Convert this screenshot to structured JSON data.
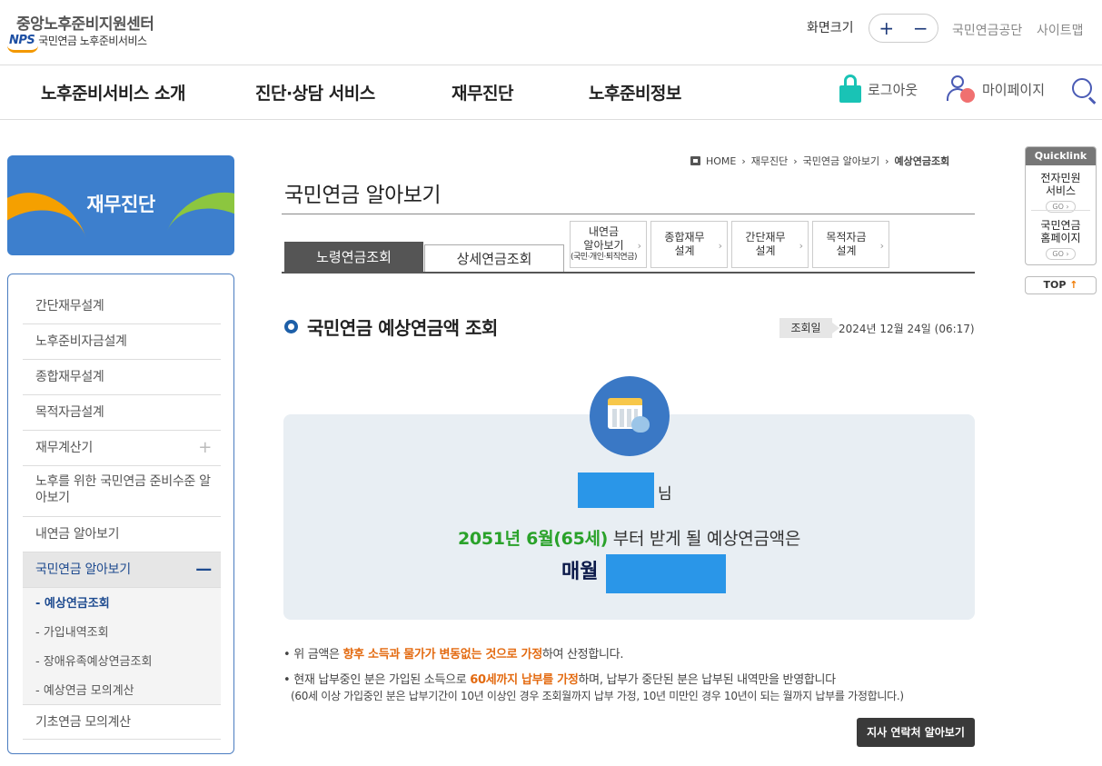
{
  "header": {
    "org_title": "중앙노후준비지원센터",
    "nps_logo_text": "NPS",
    "logo_sub": "국민연금 노후준비서비스",
    "font_size_label": "화면크기",
    "font_increase": "+",
    "font_decrease": "−",
    "links": [
      "국민연금공단",
      "사이트맵"
    ]
  },
  "gnb": {
    "items": [
      "노후준비서비스 소개",
      "진단·상담 서비스",
      "재무진단",
      "노후준비정보"
    ],
    "logout": "로그아웃",
    "mypage": "마이페이지"
  },
  "sidebar": {
    "banner_title": "재무진단",
    "items": [
      "간단재무설계",
      "노후준비자금설계",
      "종합재무설계",
      "목적자금설계",
      "재무계산기",
      "노후를 위한 국민연금 준비수준 알아보기",
      "내연금 알아보기",
      "국민연금 알아보기",
      "기초연금 모의계산"
    ],
    "plus": "+",
    "minus": "—",
    "subitems": [
      "- 예상연금조회",
      "- 가입내역조회",
      "- 장애유족예상연금조회",
      "- 예상연금 모의계산"
    ]
  },
  "breadcrumb": [
    "HOME",
    "재무진단",
    "국민연금 알아보기",
    "예상연금조회"
  ],
  "page_title": "국민연금 알아보기",
  "tabs": [
    "노령연금조회",
    "상세연금조회"
  ],
  "subtabs": [
    {
      "line1": "내연금",
      "line2": "알아보기",
      "line3": "(국민·개인·퇴직연금)"
    },
    {
      "line1": "종합재무",
      "line2": "설계",
      "line3": ""
    },
    {
      "line1": "간단재무",
      "line2": "설계",
      "line3": ""
    },
    {
      "line1": "목적자금",
      "line2": "설계",
      "line3": ""
    }
  ],
  "section": {
    "title": "국민연금 예상연금액 조회",
    "date_label": "조회일",
    "date_value": "2024년 12월 24일 (06:17)"
  },
  "result": {
    "honorific": "님",
    "start_highlight": "2051년 6월(65세)",
    "start_rest": " 부터 받게 될 예상연금액은",
    "monthly_label": "매월"
  },
  "notes": {
    "n1_pre": "• 위 금액은 ",
    "n1_hl": "향후 소득과 물가가 변동없는 것으로 가정",
    "n1_post": "하여 산정합니다.",
    "n2_pre": "• 현재 납부중인 분은 가입된 소득으로 ",
    "n2_hl": "60세까지 납부를 가정",
    "n2_post": "하며, 납부가 중단된 분은 납부된 내역만을 반영합니다",
    "n3": "(60세 이상 가입중인 분은 납부기간이 10년 이상인 경우 조회월까지 납부 가정, 10년 미만인 경우 10년이 되는 월까지 납부를 가정합니다.)"
  },
  "branch_button": "지사 연락처 알아보기",
  "quicklink": {
    "title": "Quicklink",
    "items": [
      {
        "l1": "전자민원",
        "l2": "서비스"
      },
      {
        "l1": "국민연금",
        "l2": "홈페이지"
      }
    ],
    "go": "GO ›",
    "top": "TOP",
    "top_arrow": "↑"
  }
}
